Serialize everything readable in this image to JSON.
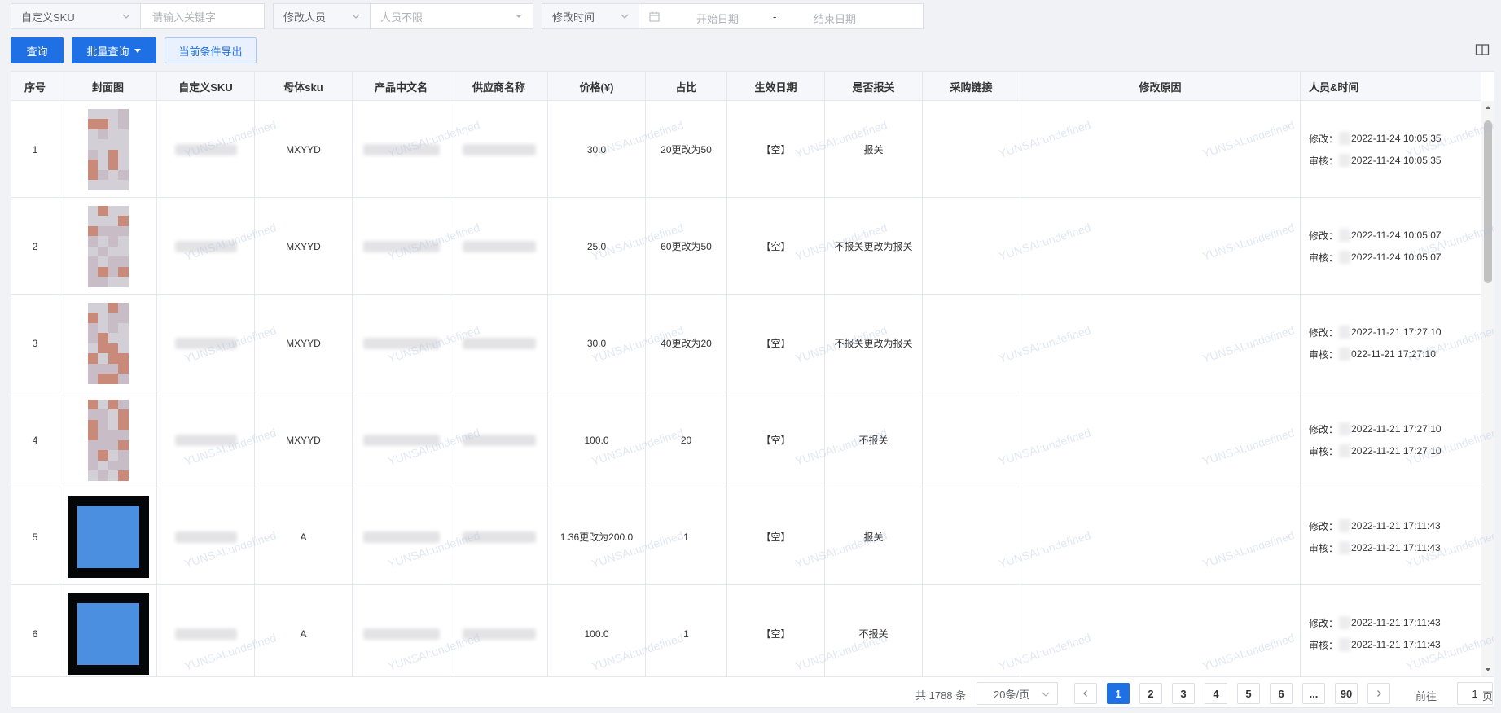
{
  "filters": {
    "sku_type": "自定义SKU",
    "keyword_placeholder": "请输入关键字",
    "person_type": "修改人员",
    "person_value": "人员不限",
    "time_type": "修改时间",
    "start_date_placeholder": "开始日期",
    "date_separator": "-",
    "end_date_placeholder": "结束日期"
  },
  "toolbar": {
    "query_label": "查询",
    "batch_query_label": "批量查询",
    "export_label": "当前条件导出"
  },
  "table": {
    "columns": [
      "序号",
      "封面图",
      "自定义SKU",
      "母体sku",
      "产品中文名",
      "供应商名称",
      "价格(¥)",
      "占比",
      "生效日期",
      "是否报关",
      "采购链接",
      "修改原因",
      "人员&时间"
    ],
    "modify_label": "修改：",
    "audit_label": "审核：",
    "rows": [
      {
        "index": "1",
        "parent_sku": "MXYYD",
        "price": "30.0",
        "ratio": "20更改为50",
        "effective": "【空】",
        "customs": "报关",
        "modify_time": "2022-11-24 10:05:35",
        "audit_time": "2022-11-24 10:05:35",
        "thumb": "pink"
      },
      {
        "index": "2",
        "parent_sku": "MXYYD",
        "price": "25.0",
        "ratio": "60更改为50",
        "effective": "【空】",
        "customs": "不报关更改为报关",
        "modify_time": "2022-11-24 10:05:07",
        "audit_time": "2022-11-24 10:05:07",
        "thumb": "pink"
      },
      {
        "index": "3",
        "parent_sku": "MXYYD",
        "price": "30.0",
        "ratio": "40更改为20",
        "effective": "【空】",
        "customs": "不报关更改为报关",
        "modify_time": "2022-11-21 17:27:10",
        "audit_time": "022-11-21 17:27:10",
        "thumb": "pink"
      },
      {
        "index": "4",
        "parent_sku": "MXYYD",
        "price": "100.0",
        "ratio": "20",
        "effective": "【空】",
        "customs": "不报关",
        "modify_time": "2022-11-21 17:27:10",
        "audit_time": "2022-11-21 17:27:10",
        "thumb": "pink"
      },
      {
        "index": "5",
        "parent_sku": "A",
        "price": "1.36更改为200.0",
        "ratio": "1",
        "effective": "【空】",
        "customs": "报关",
        "modify_time": "2022-11-21 17:11:43",
        "audit_time": "2022-11-21 17:11:43",
        "thumb": "blue"
      },
      {
        "index": "6",
        "parent_sku": "A",
        "price": "100.0",
        "ratio": "1",
        "effective": "【空】",
        "customs": "不报关",
        "modify_time": "2022-11-21 17:11:43",
        "audit_time": "2022-11-21 17:11:43",
        "thumb": "blue"
      }
    ]
  },
  "watermark_text": "YUNSAI:undefined",
  "pagination": {
    "total": "共 1788 条",
    "page_size": "20条/页",
    "pages": [
      "1",
      "2",
      "3",
      "4",
      "5",
      "6",
      "...",
      "90"
    ],
    "active_page": "1",
    "goto_label": "前往",
    "goto_value": "1",
    "page_unit": "页"
  },
  "colors": {
    "primary": "#1f6fe5",
    "header_bg": "#f5f7fa",
    "border": "#e4e7ed"
  }
}
